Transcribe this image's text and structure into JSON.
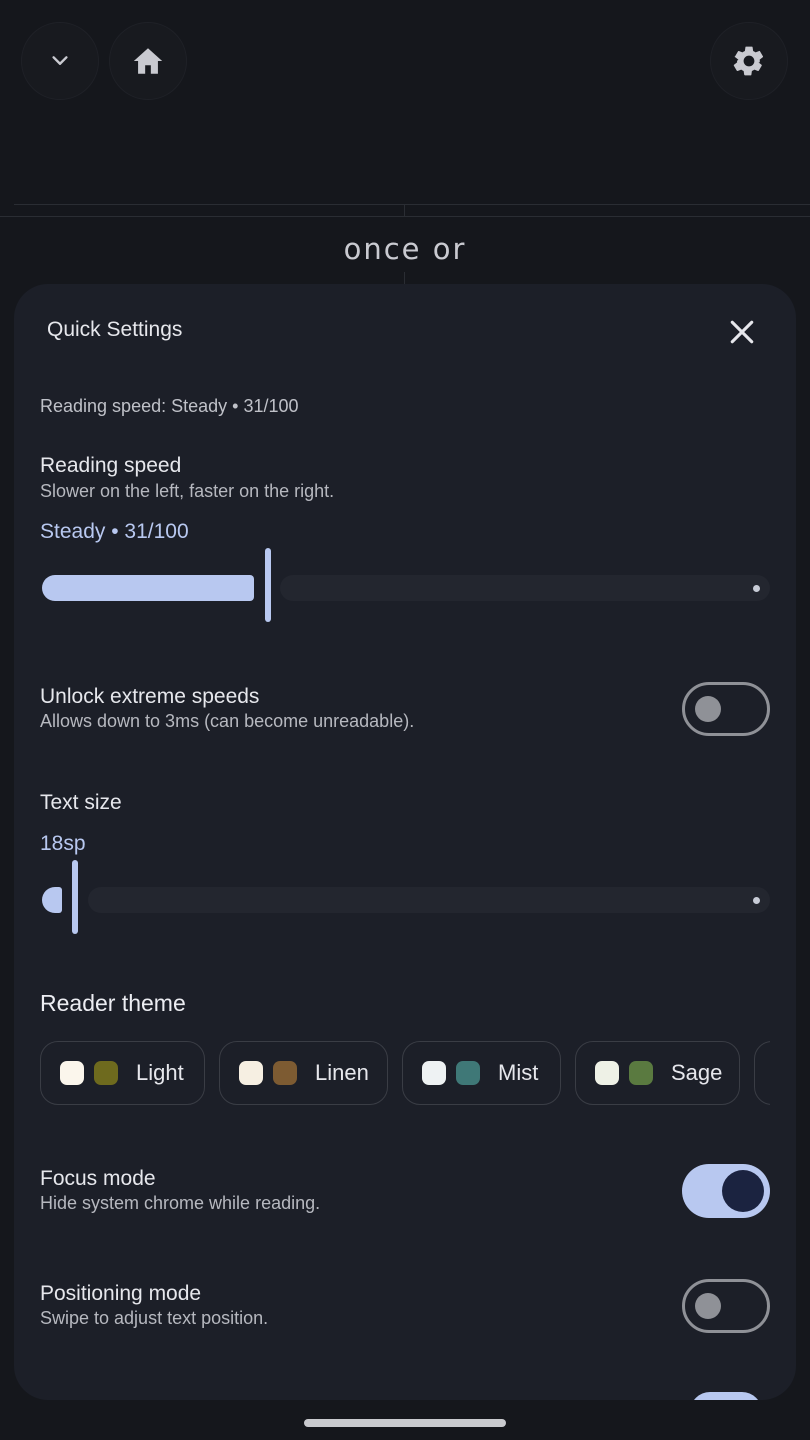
{
  "topbar": {
    "collapse_icon": "chevron-down-icon",
    "home_icon": "home-icon",
    "settings_icon": "gear-icon"
  },
  "reader": {
    "word": "once or"
  },
  "sheet": {
    "title": "Quick Settings",
    "close_icon": "close-icon",
    "summary": "Reading speed: Steady • 31/100",
    "reading_speed": {
      "title": "Reading speed",
      "subtitle": "Slower on the left, faster on the right.",
      "value_label": "Steady • 31/100",
      "value": 31,
      "max": 100
    },
    "extreme_speeds": {
      "title": "Unlock extreme speeds",
      "subtitle": "Allows down to 3ms (can become unreadable).",
      "enabled": false
    },
    "text_size": {
      "title": "Text size",
      "value_label": "18sp"
    },
    "reader_theme": {
      "title": "Reader theme",
      "options": [
        {
          "label": "Light",
          "bg": "#fbf6ec",
          "accent": "#6e6a1e"
        },
        {
          "label": "Linen",
          "bg": "#f6efe2",
          "accent": "#7d5b32"
        },
        {
          "label": "Mist",
          "bg": "#eef2f3",
          "accent": "#3f7877"
        },
        {
          "label": "Sage",
          "bg": "#eef1e6",
          "accent": "#5a7a40"
        }
      ]
    },
    "focus_mode": {
      "title": "Focus mode",
      "subtitle": "Hide system chrome while reading.",
      "enabled": true
    },
    "positioning_mode": {
      "title": "Positioning mode",
      "subtitle": "Swipe to adjust text position.",
      "enabled": false
    }
  },
  "colors": {
    "accent": "#b8c8f0",
    "sheet_bg": "#1c1f28",
    "page_bg": "#15171c"
  }
}
